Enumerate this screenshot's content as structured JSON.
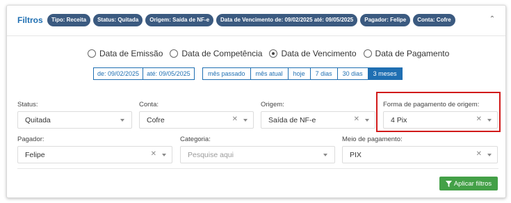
{
  "header": {
    "title": "Filtros",
    "chips": [
      "Tipo: Receita",
      "Status: Quitada",
      "Origem: Saída de NF-e",
      "Data de Vencimento de: 09/02/2025 até: 09/05/2025",
      "Pagador: Felipe",
      "Conta: Cofre"
    ],
    "collapse_icon": "chevron-up-icon"
  },
  "date_type": {
    "options": [
      "Data de Emissão",
      "Data de Competência",
      "Data de Vencimento",
      "Data de Pagamento"
    ],
    "selected": "Data de Vencimento"
  },
  "date_range": {
    "from": "de: 09/02/2025",
    "to": "até: 09/05/2025"
  },
  "quick_ranges": {
    "items": [
      "mês passado",
      "mês atual",
      "hoje",
      "7 dias",
      "30 dias",
      "3 meses"
    ],
    "active": "3 meses"
  },
  "fields": {
    "status": {
      "label": "Status:",
      "value": "Quitada"
    },
    "conta": {
      "label": "Conta:",
      "value": "Cofre"
    },
    "origem": {
      "label": "Origem:",
      "value": "Saída de NF-e"
    },
    "forma_pagamento": {
      "label": "Forma de pagamento de origem:",
      "value": "4 Pix"
    },
    "pagador": {
      "label": "Pagador:",
      "value": "Felipe"
    },
    "categoria": {
      "label": "Categoria:",
      "placeholder": "Pesquise aqui"
    },
    "meio_pagamento": {
      "label": "Meio de pagamento:",
      "value": "PIX"
    }
  },
  "apply_button": {
    "label": "Aplicar filtros"
  },
  "colors": {
    "accent": "#1f6fb2",
    "chip": "#3b5a80",
    "apply": "#43a047",
    "highlight": "#d11a1a"
  }
}
